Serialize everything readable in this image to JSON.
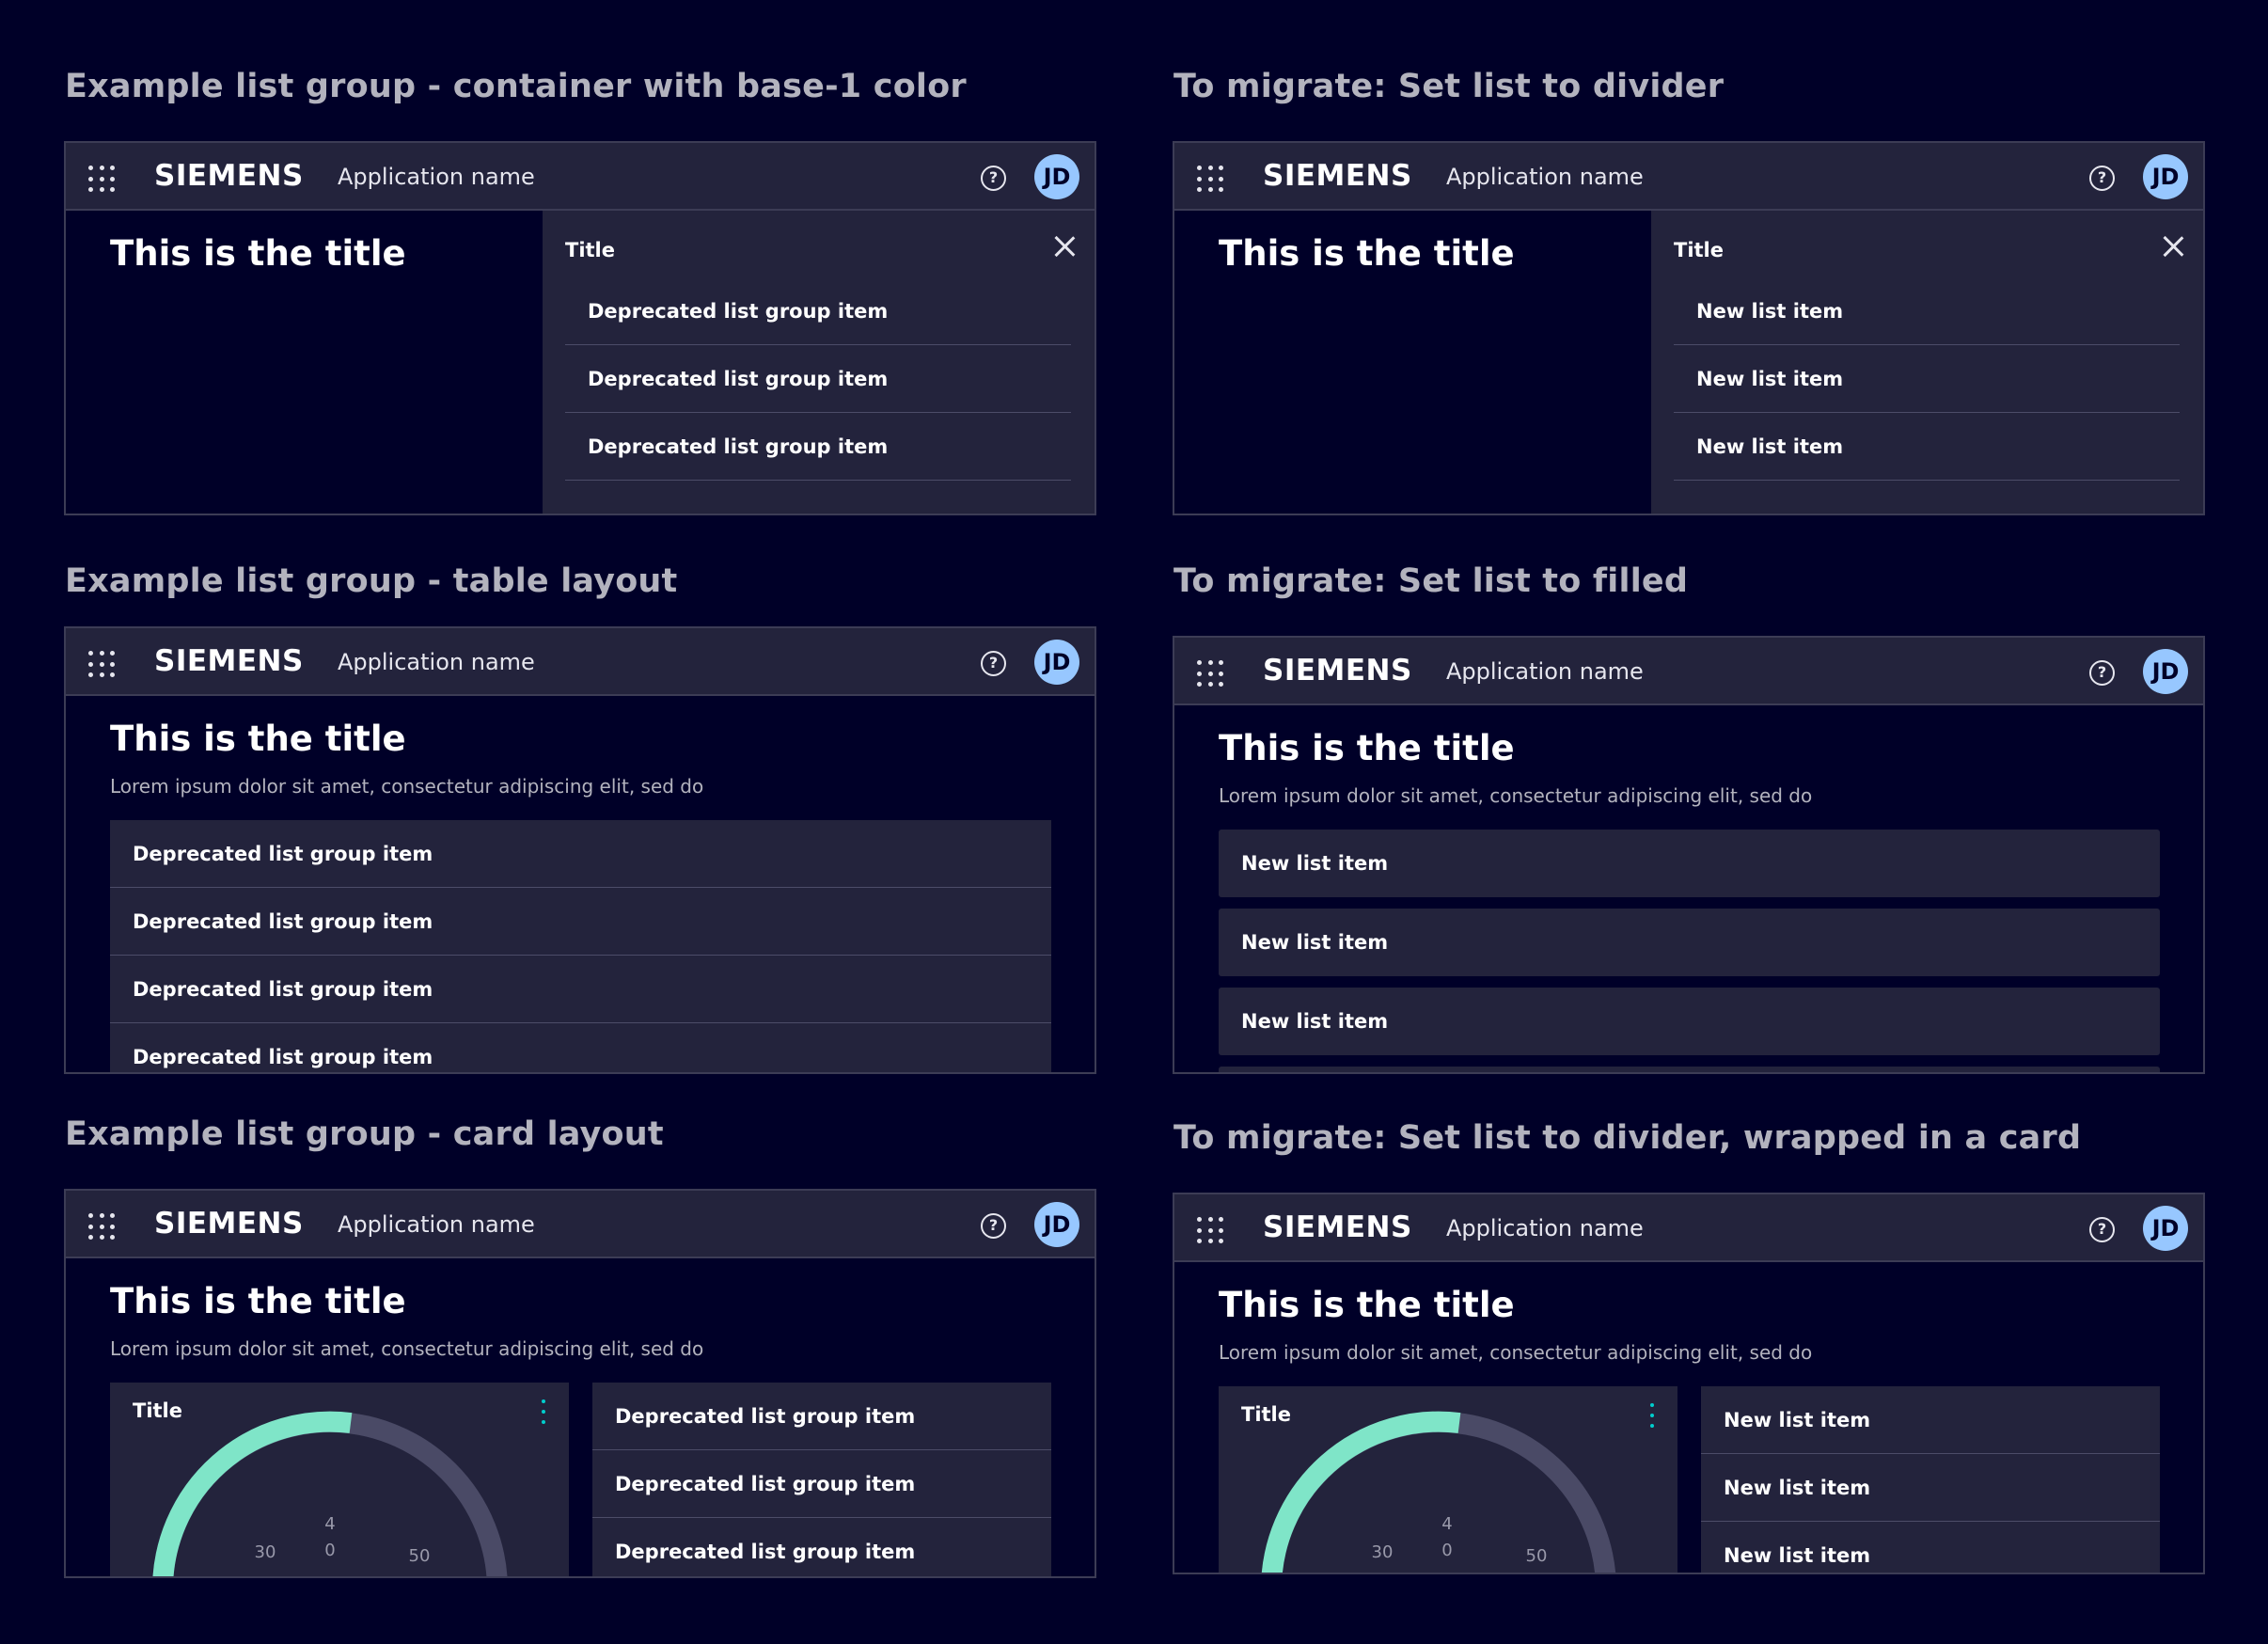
{
  "app": {
    "brand": "SIEMENS",
    "app_name": "Application name",
    "avatar_initials": "JD",
    "help_glyph": "?"
  },
  "page": {
    "title": "This is the title",
    "description": "Lorem ipsum dolor sit amet, consectetur adipiscing elit, sed do"
  },
  "sections": {
    "example_base": {
      "heading": "Example list group - container with base-1 color",
      "panel_title": "Title",
      "items": [
        "Deprecated list group item",
        "Deprecated list group item",
        "Deprecated list group item"
      ]
    },
    "migrate_divider": {
      "heading": "To migrate: Set list to divider",
      "panel_title": "Title",
      "items": [
        "New list item",
        "New list item",
        "New list item"
      ]
    },
    "example_table": {
      "heading": "Example list group - table layout",
      "items": [
        "Deprecated list group item",
        "Deprecated list group item",
        "Deprecated list group item",
        "Deprecated list group item"
      ]
    },
    "migrate_filled": {
      "heading": "To migrate: Set list to filled",
      "items": [
        "New list item",
        "New list item",
        "New list item",
        ""
      ]
    },
    "example_card": {
      "heading": "Example list group - card layout",
      "card_title": "Title",
      "gauge_labels": [
        "30",
        "4",
        "0",
        "50"
      ],
      "items": [
        "Deprecated list group item",
        "Deprecated list group item",
        "Deprecated list group item"
      ]
    },
    "migrate_card": {
      "heading": "To migrate: Set list to divider, wrapped in a card",
      "card_title": "Title",
      "gauge_labels": [
        "30",
        "4",
        "0",
        "50"
      ],
      "items": [
        "New list item",
        "New list item",
        "New list item"
      ]
    }
  },
  "colors": {
    "background": "#000028",
    "surface": "#23233c",
    "border": "#3c3c55",
    "avatar": "#97c7ff",
    "accent_gauge": "#7fe5c8",
    "accent_kebab": "#00cccc"
  },
  "icons": [
    "app-launcher-icon",
    "help-icon",
    "close-icon",
    "kebab-menu-icon"
  ]
}
